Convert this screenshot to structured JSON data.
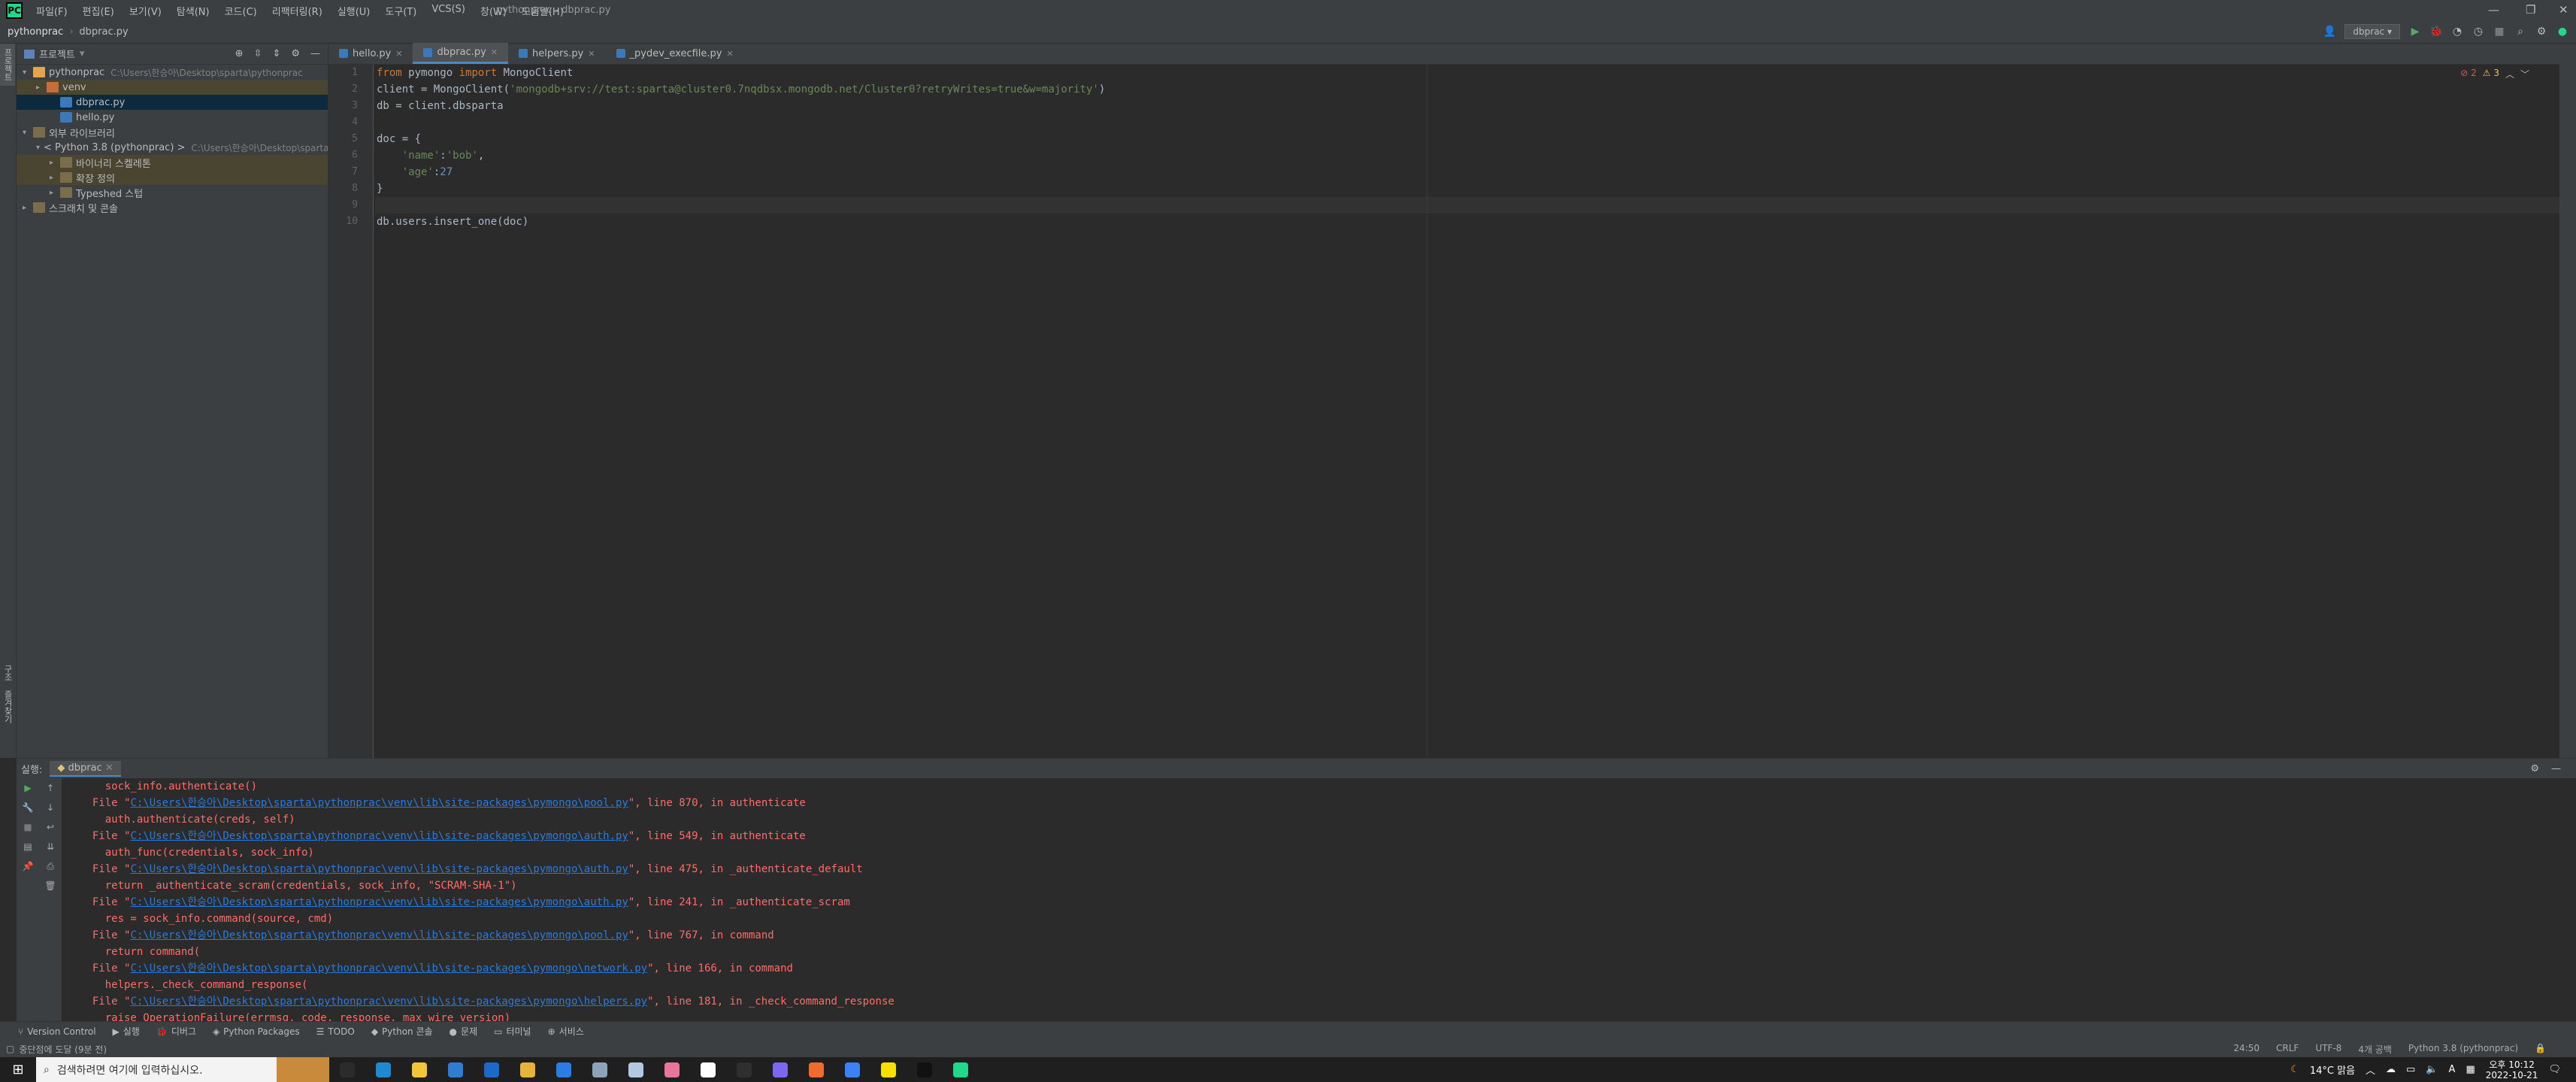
{
  "menubar": {
    "logo": "PC",
    "items": [
      "파일(F)",
      "편집(E)",
      "보기(V)",
      "탐색(N)",
      "코드(C)",
      "리팩터링(R)",
      "실행(U)",
      "도구(T)",
      "VCS(S)",
      "창(W)",
      "도움말(H)"
    ],
    "title": "pythonprac - dbprac.py"
  },
  "navbar": {
    "breadcrumbs": [
      "pythonprac",
      "dbprac.py"
    ],
    "run_config": "dbprac"
  },
  "left_stripe": [
    "프로젝트"
  ],
  "left_stripe_bottom": [
    "구조",
    "즐겨찾기"
  ],
  "project": {
    "header": "프로젝트",
    "tree": [
      {
        "label": "pythonprac",
        "path": "C:\\Users\\한승아\\Desktop\\sparta\\pythonprac",
        "icon": "folder",
        "indent": 0,
        "arrow": "▾"
      },
      {
        "label": "venv",
        "path": "",
        "icon": "folder-red",
        "indent": 1,
        "arrow": "▸",
        "highlight": true
      },
      {
        "label": "dbprac.py",
        "path": "",
        "icon": "pyfile",
        "indent": 2,
        "arrow": "",
        "selected": true
      },
      {
        "label": "hello.py",
        "path": "",
        "icon": "pyfile",
        "indent": 2,
        "arrow": ""
      },
      {
        "label": "외부 라이브러리",
        "path": "",
        "icon": "lib",
        "indent": 0,
        "arrow": "▾"
      },
      {
        "label": "< Python 3.8 (pythonprac) >",
        "path": "C:\\Users\\한승아\\Desktop\\sparta\\",
        "icon": "lib",
        "indent": 1,
        "arrow": "▾"
      },
      {
        "label": "바이너리 스켈레톤",
        "path": "",
        "icon": "lib",
        "indent": 2,
        "arrow": "▸",
        "highlight": true
      },
      {
        "label": "확장 정의",
        "path": "",
        "icon": "lib",
        "indent": 2,
        "arrow": "▸",
        "highlight": true
      },
      {
        "label": "Typeshed 스텁",
        "path": "",
        "icon": "lib",
        "indent": 2,
        "arrow": "▸"
      },
      {
        "label": "스크래치 및 콘솔",
        "path": "",
        "icon": "lib",
        "indent": 0,
        "arrow": "▸"
      }
    ]
  },
  "editor": {
    "tabs": [
      {
        "label": "hello.py",
        "active": false
      },
      {
        "label": "dbprac.py",
        "active": true
      },
      {
        "label": "helpers.py",
        "active": false
      },
      {
        "label": "_pydev_execfile.py",
        "active": false
      }
    ],
    "line_numbers": [
      "1",
      "2",
      "3",
      "4",
      "5",
      "6",
      "7",
      "8",
      "9",
      "10"
    ],
    "inspection": {
      "errors": "2",
      "warnings": "3"
    }
  },
  "code_lines": [
    [
      {
        "t": "kw",
        "s": "from "
      },
      {
        "t": "",
        "s": "pymongo "
      },
      {
        "t": "kw",
        "s": "import "
      },
      {
        "t": "",
        "s": "MongoClient"
      }
    ],
    [
      {
        "t": "",
        "s": "client = MongoClient("
      },
      {
        "t": "str",
        "s": "'mongodb+srv://test:sparta@cluster0.7nqdbsx.mongodb.net/Cluster0?retryWrites=true&w=majority'"
      },
      {
        "t": "",
        "s": ")"
      }
    ],
    [
      {
        "t": "",
        "s": "db = client.dbsparta"
      }
    ],
    [],
    [
      {
        "t": "",
        "s": "doc = {"
      }
    ],
    [
      {
        "t": "str",
        "s": "    'name'"
      },
      {
        "t": "",
        "s": ":"
      },
      {
        "t": "str",
        "s": "'bob'"
      },
      {
        "t": "",
        "s": ","
      }
    ],
    [
      {
        "t": "str",
        "s": "    'age'"
      },
      {
        "t": "",
        "s": ":"
      },
      {
        "t": "num",
        "s": "27"
      }
    ],
    [
      {
        "t": "",
        "s": "}"
      }
    ],
    [],
    [
      {
        "t": "",
        "s": "db.users.insert_one(doc)"
      }
    ]
  ],
  "run": {
    "label": "실행:",
    "tab": "dbprac",
    "console": [
      {
        "prefix": "    sock_info.authenticate()",
        "link": "",
        "suffix": ""
      },
      {
        "prefix": "  File \"",
        "link": "C:\\Users\\한승아\\Desktop\\sparta\\pythonprac\\venv\\lib\\site-packages\\pymongo\\pool.py",
        "suffix": "\", line 870, in authenticate"
      },
      {
        "prefix": "    auth.authenticate(creds, self)",
        "link": "",
        "suffix": ""
      },
      {
        "prefix": "  File \"",
        "link": "C:\\Users\\한승아\\Desktop\\sparta\\pythonprac\\venv\\lib\\site-packages\\pymongo\\auth.py",
        "suffix": "\", line 549, in authenticate"
      },
      {
        "prefix": "    auth_func(credentials, sock_info)",
        "link": "",
        "suffix": ""
      },
      {
        "prefix": "  File \"",
        "link": "C:\\Users\\한승아\\Desktop\\sparta\\pythonprac\\venv\\lib\\site-packages\\pymongo\\auth.py",
        "suffix": "\", line 475, in _authenticate_default"
      },
      {
        "prefix": "    return _authenticate_scram(credentials, sock_info, \"SCRAM-SHA-1\")",
        "link": "",
        "suffix": ""
      },
      {
        "prefix": "  File \"",
        "link": "C:\\Users\\한승아\\Desktop\\sparta\\pythonprac\\venv\\lib\\site-packages\\pymongo\\auth.py",
        "suffix": "\", line 241, in _authenticate_scram"
      },
      {
        "prefix": "    res = sock_info.command(source, cmd)",
        "link": "",
        "suffix": ""
      },
      {
        "prefix": "  File \"",
        "link": "C:\\Users\\한승아\\Desktop\\sparta\\pythonprac\\venv\\lib\\site-packages\\pymongo\\pool.py",
        "suffix": "\", line 767, in command"
      },
      {
        "prefix": "    return command(",
        "link": "",
        "suffix": ""
      },
      {
        "prefix": "  File \"",
        "link": "C:\\Users\\한승아\\Desktop\\sparta\\pythonprac\\venv\\lib\\site-packages\\pymongo\\network.py",
        "suffix": "\", line 166, in command"
      },
      {
        "prefix": "    helpers._check_command_response(",
        "link": "",
        "suffix": ""
      },
      {
        "prefix": "  File \"",
        "link": "C:\\Users\\한승아\\Desktop\\sparta\\pythonprac\\venv\\lib\\site-packages\\pymongo\\helpers.py",
        "suffix": "\", line 181, in _check_command_response"
      },
      {
        "prefix": "    raise OperationFailure(errmsg, code, response, max_wire_version)",
        "link": "",
        "suffix": ""
      }
    ]
  },
  "bottom_tools": [
    "Version Control",
    "실행",
    "디버그",
    "Python Packages",
    "TODO",
    "Python 콘솔",
    "문제",
    "터미널",
    "서비스"
  ],
  "status": {
    "message": "중단점에 도달 (9분 전)",
    "position": "24:50",
    "line_sep": "CRLF",
    "encoding": "UTF-8",
    "indent": "4개 공백",
    "interpreter": "Python 3.8 (pythonprac)"
  },
  "taskbar": {
    "search_placeholder": "검색하려면 여기에 입력하십시오.",
    "apps": [
      {
        "name": "task-view",
        "color": "#2b2b2b"
      },
      {
        "name": "edge",
        "color": "#1f8ad2"
      },
      {
        "name": "file-explorer",
        "color": "#f0c43b"
      },
      {
        "name": "store",
        "color": "#2d7dd2"
      },
      {
        "name": "mail",
        "color": "#1b6ac9"
      },
      {
        "name": "chrome",
        "color": "#e8b339"
      },
      {
        "name": "app-blue",
        "color": "#2a7de1"
      },
      {
        "name": "app-gray",
        "color": "#8fa3b8"
      },
      {
        "name": "app-chat",
        "color": "#b3c8e0"
      },
      {
        "name": "app-pink",
        "color": "#e8769a"
      },
      {
        "name": "notion",
        "color": "#ffffff"
      },
      {
        "name": "app-dark",
        "color": "#2f2f2f"
      },
      {
        "name": "app-purple",
        "color": "#7b68ee"
      },
      {
        "name": "app-orange",
        "color": "#f06b2f"
      },
      {
        "name": "app-blue2",
        "color": "#3b82f6"
      },
      {
        "name": "kakaotalk",
        "color": "#f9e000"
      },
      {
        "name": "app-black",
        "color": "#111111"
      },
      {
        "name": "pycharm",
        "color": "#21d789"
      }
    ],
    "weather": "14°C 맑음",
    "ime": "A",
    "time": "오후 10:12",
    "date": "2022-10-21"
  }
}
